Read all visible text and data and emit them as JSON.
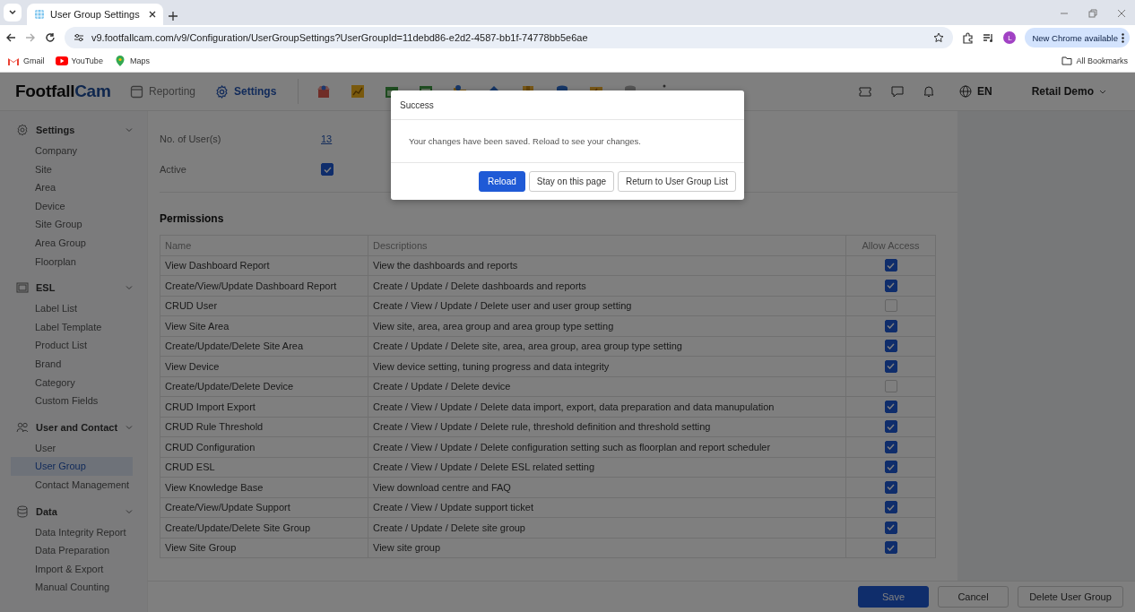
{
  "browser": {
    "tab_title": "User Group Settings",
    "url": "v9.footfallcam.com/v9/Configuration/UserGroupSettings?UserGroupId=11debd86-e2d2-4587-bb1f-74778bb5e6ae",
    "profile_initial": "L",
    "update_button": "New Chrome available",
    "bookmarks": [
      {
        "label": "Gmail"
      },
      {
        "label": "YouTube"
      },
      {
        "label": "Maps"
      }
    ],
    "all_bookmarks": "All Bookmarks"
  },
  "header": {
    "logo": {
      "text": "Footfall",
      "accent": "Cam"
    },
    "nav": [
      {
        "label": "Reporting",
        "selected": false
      },
      {
        "label": "Settings",
        "selected": true
      }
    ],
    "language": "EN",
    "account": "Retail Demo"
  },
  "sidebar": {
    "sections": [
      {
        "title": "Settings",
        "expanded": true,
        "items": [
          {
            "label": "Company",
            "selected": false
          },
          {
            "label": "Site",
            "selected": false
          },
          {
            "label": "Area",
            "selected": false
          },
          {
            "label": "Device",
            "selected": false
          },
          {
            "label": "Site Group",
            "selected": false
          },
          {
            "label": "Area Group",
            "selected": false
          },
          {
            "label": "Floorplan",
            "selected": false
          }
        ]
      },
      {
        "title": "ESL",
        "expanded": true,
        "items": [
          {
            "label": "Label List",
            "selected": false
          },
          {
            "label": "Label Template",
            "selected": false
          },
          {
            "label": "Product List",
            "selected": false
          },
          {
            "label": "Brand",
            "selected": false
          },
          {
            "label": "Category",
            "selected": false
          },
          {
            "label": "Custom Fields",
            "selected": false
          }
        ]
      },
      {
        "title": "User and Contact",
        "expanded": true,
        "items": [
          {
            "label": "User",
            "selected": false
          },
          {
            "label": "User Group",
            "selected": true
          },
          {
            "label": "Contact Management",
            "selected": false
          }
        ]
      },
      {
        "title": "Data",
        "expanded": true,
        "items": [
          {
            "label": "Data Integrity Report",
            "selected": false
          },
          {
            "label": "Data Preparation",
            "selected": false
          },
          {
            "label": "Import & Export",
            "selected": false
          },
          {
            "label": "Manual Counting",
            "selected": false
          }
        ]
      }
    ]
  },
  "form": {
    "fields": [
      {
        "label": "No. of User(s)",
        "kind": "link",
        "value": "13"
      },
      {
        "label": "Active",
        "kind": "checkbox",
        "checked": true
      }
    ]
  },
  "permissions": {
    "title": "Permissions",
    "columns": [
      "Name",
      "Descriptions",
      "Allow Access"
    ],
    "rows": [
      {
        "name": "View Dashboard Report",
        "description": "View the dashboards and reports",
        "allowed": true
      },
      {
        "name": "Create/View/Update Dashboard Report",
        "description": "Create / Update / Delete dashboards and reports",
        "allowed": true
      },
      {
        "name": "CRUD User",
        "description": "Create / View / Update / Delete user and user group setting",
        "allowed": false
      },
      {
        "name": "View Site Area",
        "description": "View site, area, area group and area group type setting",
        "allowed": true
      },
      {
        "name": "Create/Update/Delete Site Area",
        "description": "Create / Update / Delete site, area, area group, area group type setting",
        "allowed": true
      },
      {
        "name": "View Device",
        "description": "View device setting, tuning progress and data integrity",
        "allowed": true
      },
      {
        "name": "Create/Update/Delete Device",
        "description": "Create / Update / Delete device",
        "allowed": false
      },
      {
        "name": "CRUD Import Export",
        "description": "Create / View / Update / Delete data import, export, data preparation and data manupulation",
        "allowed": true
      },
      {
        "name": "CRUD Rule Threshold",
        "description": "Create / View / Update / Delete rule, threshold definition and threshold setting",
        "allowed": true
      },
      {
        "name": "CRUD Configuration",
        "description": "Create / View / Update / Delete configuration setting such as floorplan and report scheduler",
        "allowed": true
      },
      {
        "name": "CRUD ESL",
        "description": "Create / View / Update / Delete ESL related setting",
        "allowed": true
      },
      {
        "name": "View Knowledge Base",
        "description": "View download centre and FAQ",
        "allowed": true
      },
      {
        "name": "Create/View/Update Support",
        "description": "Create / View / Update support ticket",
        "allowed": true
      },
      {
        "name": "Create/Update/Delete Site Group",
        "description": "Create / Update / Delete site group",
        "allowed": true
      },
      {
        "name": "View Site Group",
        "description": "View site group",
        "allowed": true
      }
    ]
  },
  "footer": {
    "buttons": [
      {
        "label": "Save",
        "kind": "primary"
      },
      {
        "label": "Cancel",
        "kind": "default"
      },
      {
        "label": "Delete User Group",
        "kind": "default"
      }
    ]
  },
  "dialog": {
    "title": "Success",
    "message": "Your changes have been saved. Reload to see your changes.",
    "buttons": [
      {
        "label": "Reload",
        "kind": "primary"
      },
      {
        "label": "Stay on this page",
        "kind": "default"
      },
      {
        "label": "Return to User Group List",
        "kind": "default"
      }
    ]
  }
}
